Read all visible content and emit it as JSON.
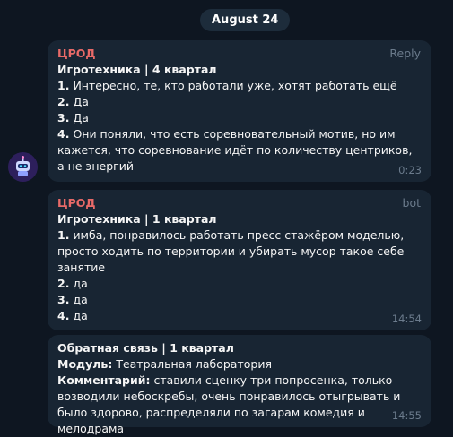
{
  "date": "August 24",
  "messages": [
    {
      "sender": "ЦРОД",
      "tag": "Reply",
      "title": "Игротехника | 4 квартал",
      "items": [
        {
          "num": "1.",
          "text": "Интересно, те, кто работали уже, хотят работать ещё"
        },
        {
          "num": "2.",
          "text": "Да"
        },
        {
          "num": "3.",
          "text": "Да"
        },
        {
          "num": "4.",
          "text": "Они поняли, что есть соревновательный мотив, но им кажется, что соревнование идёт по количеству центриков, а не энергий"
        }
      ],
      "time": "0:23"
    },
    {
      "sender": "ЦРОД",
      "tag": "bot",
      "title": "Игротехника | 1 квартал",
      "items": [
        {
          "num": "1.",
          "text": "имба, понравилось работать пресс стажёром моделью, просто ходить по территории и убирать мусор такое себе занятие"
        },
        {
          "num": "2.",
          "text": "да"
        },
        {
          "num": "3.",
          "text": "да"
        },
        {
          "num": "4.",
          "text": "да"
        }
      ],
      "time": "14:54"
    },
    {
      "title": "Обратная связь | 1 квартал",
      "module_label": "Модуль:",
      "module_value": "Театральная лаборатория",
      "comment_label": "Комментарий:",
      "comment_value": "ставили сценку три попросенка, только возводили небоскребы, очень понравилось отыгрывать и было здорово, распределяли по загарам комедия и мелодрама",
      "time": "14:55"
    }
  ]
}
